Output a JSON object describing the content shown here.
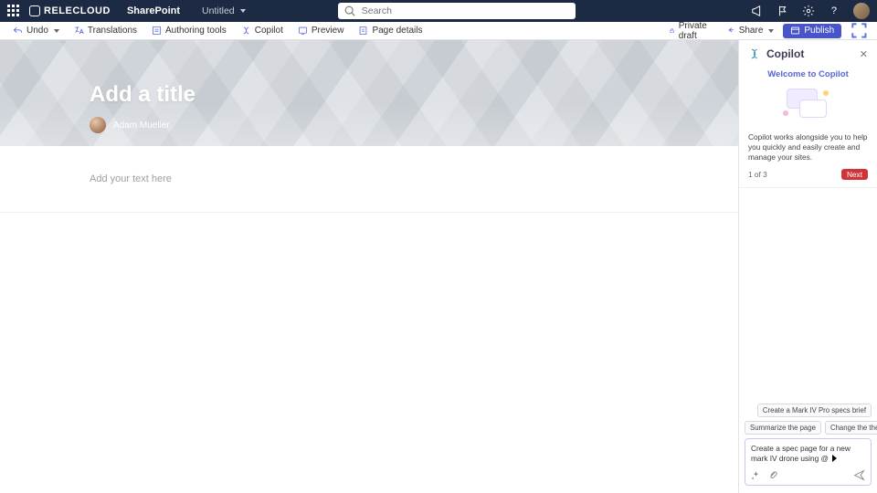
{
  "header": {
    "brand": "RELECLOUD",
    "product": "SharePoint",
    "doc_title": "Untitled",
    "search_placeholder": "Search"
  },
  "toolbar": {
    "undo": "Undo",
    "translations": "Translations",
    "authoring": "Authoring tools",
    "copilot": "Copilot",
    "preview": "Preview",
    "page_details": "Page details",
    "private_draft": "Private draft",
    "share": "Share",
    "publish": "Publish"
  },
  "hero": {
    "title_placeholder": "Add a title",
    "author": "Adam Mueller"
  },
  "body": {
    "placeholder": "Add your text here"
  },
  "copilot": {
    "title": "Copilot",
    "welcome": "Welcome to Copilot",
    "desc": "Copilot works alongside you to help you quickly and easily create and manage your sites.",
    "pager": "1 of 3",
    "next": "Next",
    "chip_brief": "Create a Mark IV Pro specs brief",
    "chip_summarize": "Summarize the page",
    "chip_theme": "Change the theme",
    "prompt_value": "Create a spec page for a new mark IV drone using @"
  }
}
